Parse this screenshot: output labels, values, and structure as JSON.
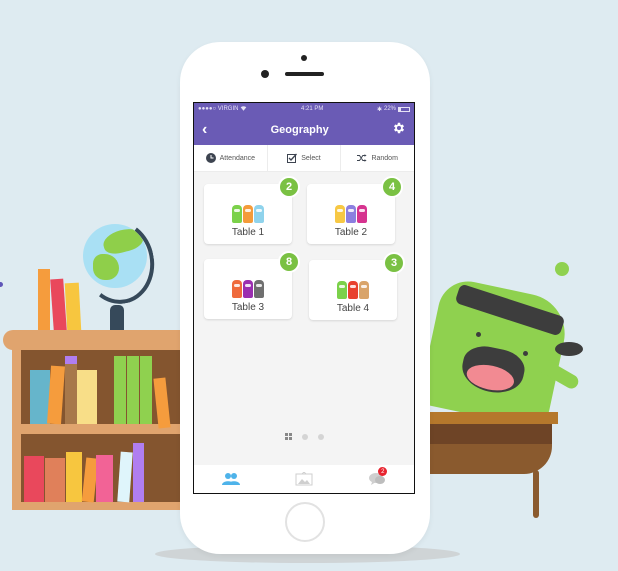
{
  "statusbar": {
    "carrier": "●●●●○ VIRGIN",
    "wifi_icon": "wifi-icon",
    "time": "4:21 PM",
    "bluetooth_icon": "bluetooth-icon",
    "battery_percent": "22%",
    "battery_level": 0.22
  },
  "navbar": {
    "back_icon": "chevron-left-icon",
    "back_glyph": "‹",
    "title": "Geography",
    "settings_icon": "gear-icon"
  },
  "toolbar": {
    "items": [
      {
        "label": "Attendance",
        "icon": "clock-icon"
      },
      {
        "label": "Select",
        "icon": "checkbox-icon"
      },
      {
        "label": "Random",
        "icon": "shuffle-icon"
      }
    ]
  },
  "tables": [
    {
      "label": "Table 1",
      "count": "2",
      "monster_colors": [
        "#7bd14a",
        "#f49b3a",
        "#8fd3ec"
      ]
    },
    {
      "label": "Table 2",
      "count": "4",
      "monster_colors": [
        "#f7c844",
        "#8c7fe0",
        "#d6338f"
      ]
    },
    {
      "label": "Table 3",
      "count": "8",
      "monster_colors": [
        "#ef6a3c",
        "#9b2fb0",
        "#6f6f6f"
      ]
    },
    {
      "label": "Table 4",
      "count": "3",
      "monster_colors": [
        "#7bd14a",
        "#e8412e",
        "#d9a46a"
      ]
    }
  ],
  "pager": {
    "pages": 3,
    "current": 0
  },
  "tabbar": {
    "items": [
      {
        "name": "students",
        "icon": "students-icon",
        "active": true
      },
      {
        "name": "class-story",
        "icon": "picture-icon",
        "active": false
      },
      {
        "name": "messages",
        "icon": "chat-icon",
        "active": false,
        "badge": "2"
      }
    ]
  },
  "colors": {
    "brand_purple": "#6a5bb5",
    "badge_green": "#7ac143",
    "active_tab_blue": "#4eb3ea",
    "notification_red": "#e8242f",
    "background": "#deebf1"
  }
}
